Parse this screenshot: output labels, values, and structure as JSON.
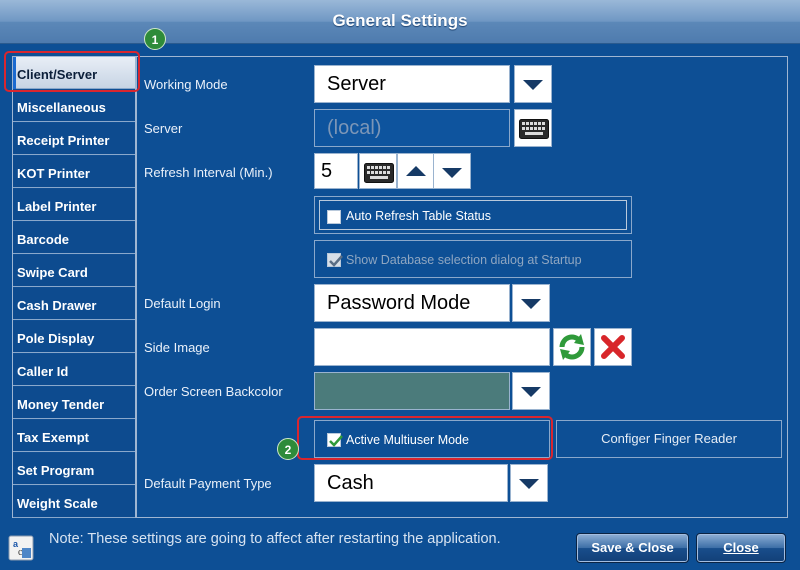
{
  "window": {
    "title": "General Settings"
  },
  "tabs": [
    "Client/Server",
    "Miscellaneous",
    "Receipt Printer",
    "KOT Printer",
    "Label Printer",
    "Barcode",
    "Swipe Card",
    "Cash Drawer",
    "Pole Display",
    "Caller Id",
    "Money Tender",
    "Tax Exempt",
    "Set Program",
    "Weight Scale"
  ],
  "active_tab": "Client/Server",
  "settings": {
    "working_mode": {
      "label": "Working Mode",
      "value": "Server"
    },
    "server": {
      "label": "Server",
      "value": "(local)"
    },
    "refresh_interval": {
      "label": "Refresh Interval (Min.)",
      "value": "5"
    },
    "auto_refresh": {
      "label": "Auto Refresh Table Status",
      "checked": false
    },
    "show_db_dialog": {
      "label": "Show Database selection dialog at Startup",
      "checked": true
    },
    "default_login": {
      "label": "Default Login",
      "value": "Password Mode"
    },
    "side_image": {
      "label": "Side Image",
      "value": ""
    },
    "order_backcolor": {
      "label": "Order Screen Backcolor",
      "color": "#4b7b7b"
    },
    "multiuser": {
      "label": "Active Multiuser Mode",
      "checked": true
    },
    "finger_reader": {
      "label": "Configer Finger Reader"
    },
    "default_payment": {
      "label": "Default Payment Type",
      "value": "Cash"
    }
  },
  "annotations": {
    "badge1": "1",
    "badge2": "2"
  },
  "footer": {
    "note": "Note: These settings are going to affect after restarting the application.",
    "save_close": "Save & Close",
    "close": "Close"
  },
  "colors": {
    "background": "#0d4f95",
    "highlight": "#d9262e",
    "badge": "#2e8b3a"
  }
}
